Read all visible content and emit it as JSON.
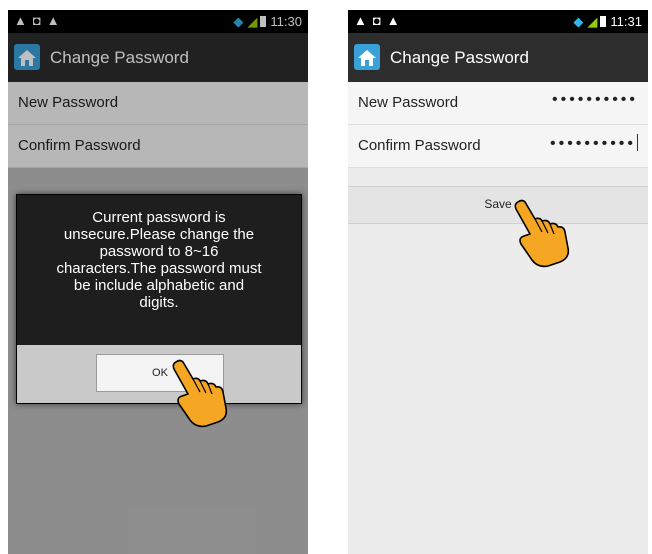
{
  "left_screen": {
    "status_bar": {
      "time": "11:30"
    },
    "action_bar": {
      "title": "Change Password"
    },
    "fields": [
      {
        "label": "New Password"
      },
      {
        "label": "Confirm Password"
      }
    ],
    "dialog": {
      "message_lines": [
        "Current password is",
        "unsecure.Please change the",
        "password to 8~16",
        "characters.The password must",
        "be include alphabetic and",
        "digits."
      ],
      "ok_label": "OK"
    }
  },
  "right_screen": {
    "status_bar": {
      "time": "11:31"
    },
    "action_bar": {
      "title": "Change Password"
    },
    "fields": [
      {
        "label": "New Password",
        "value": "••••••••••"
      },
      {
        "label": "Confirm Password",
        "value": "••••••••••"
      }
    ],
    "save_label": "Save"
  },
  "icons": [
    "home-app-icon",
    "wifi-icon",
    "signal-icon",
    "battery-icon",
    "warning-icon",
    "pointing-hand-icon"
  ],
  "colors": {
    "action_bar": "#2d2d2d",
    "status_bar": "#000000",
    "wifi": "#33b5e5",
    "signal": "#99cc00",
    "hand": "#f5a623"
  }
}
